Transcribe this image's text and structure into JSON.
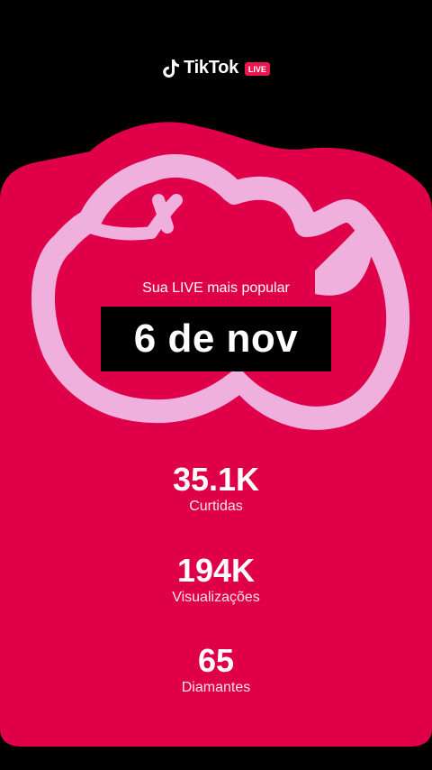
{
  "brand": {
    "name": "TikTok",
    "badge": "LIVE"
  },
  "highlight": {
    "subtitle": "Sua LIVE mais popular",
    "date": "6 de nov"
  },
  "stats": [
    {
      "value": "35.1K",
      "label": "Curtidas"
    },
    {
      "value": "194K",
      "label": "Visualizações"
    },
    {
      "value": "65",
      "label": "Diamantes"
    }
  ],
  "colors": {
    "background": "#000000",
    "card": "#e0004a",
    "outline": "#efb0de",
    "badge": "#e8174f"
  }
}
